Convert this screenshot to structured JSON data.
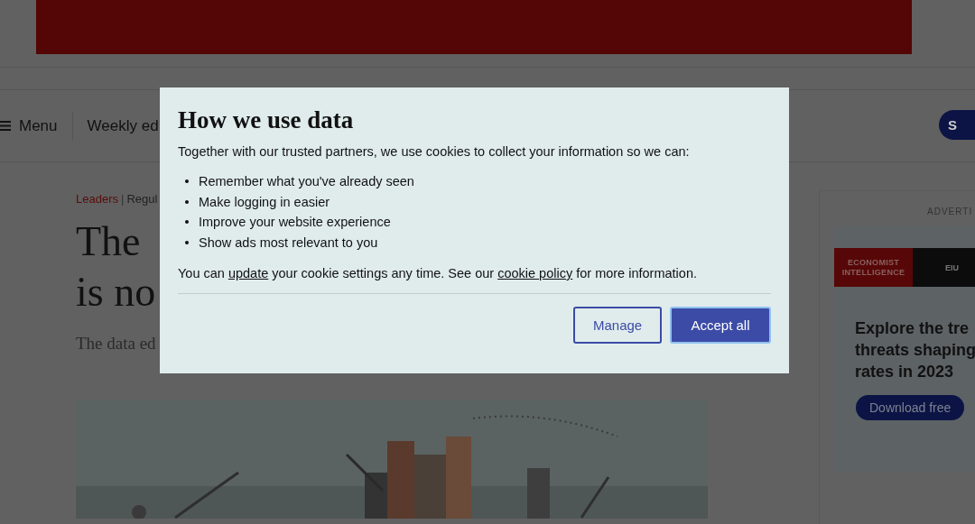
{
  "nav": {
    "menu_label": "Menu",
    "link": "Weekly ed",
    "button_label": "S"
  },
  "article": {
    "section": "Leaders",
    "separator": "|",
    "series": "Regul",
    "title_lines": [
      "The",
      "is no"
    ],
    "standfirst": "The data ed",
    "image": {
      "kind": "picture"
    }
  },
  "advert": {
    "label": "ADVERTI",
    "brand": "ECONOMIST INTELLIGENCE",
    "brand_short": "EIU",
    "heading_lines": [
      "Explore the tre",
      "threats shaping",
      "rates in 2023"
    ],
    "button_label": "Download free"
  },
  "dialog": {
    "title": "How we use data",
    "intro": "Together with our trusted partners, we use cookies to collect your information so we can:",
    "bullets": [
      "Remember what you've already seen",
      "Make logging in easier",
      "Improve your website experience",
      "Show ads most relevant to you"
    ],
    "footer": [
      {
        "kind": "text",
        "text": "You can "
      },
      {
        "kind": "link",
        "text": "update"
      },
      {
        "kind": "text",
        "text": " your cookie settings any time. See our "
      },
      {
        "kind": "link",
        "text": "cookie policy"
      },
      {
        "kind": "text",
        "text": " for more information."
      }
    ],
    "buttons": [
      {
        "kind": "secondary",
        "label": "Manage"
      },
      {
        "kind": "primary",
        "label": "Accept all"
      }
    ]
  }
}
